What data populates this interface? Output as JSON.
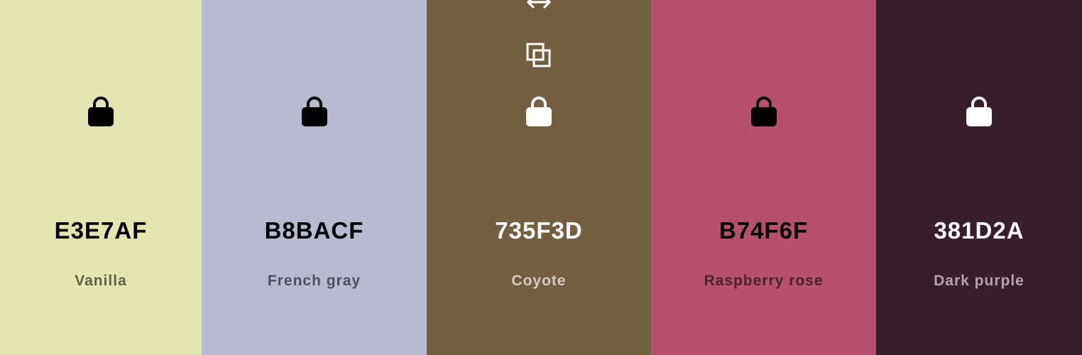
{
  "palette": {
    "colors": [
      {
        "hex": "E3E7AF",
        "name": "Vanilla",
        "background": "#E3E7AF",
        "text_color": "#000000",
        "name_color": "#5E604A",
        "icon_color": "#000000",
        "lock_icon": "lock-icon"
      },
      {
        "hex": "B8BACF",
        "name": "French gray",
        "background": "#B8BACF",
        "text_color": "#000000",
        "name_color": "#4F5059",
        "icon_color": "#000000",
        "lock_icon": "lock-icon"
      },
      {
        "hex": "735F3D",
        "name": "Coyote",
        "background": "#735F3D",
        "text_color": "#FFFFFF",
        "name_color": "#D1CBC0",
        "icon_color": "#FFFFFF",
        "lock_icon": "lock-icon",
        "hover_icons": [
          "drag-arrows-icon",
          "copy-icon"
        ]
      },
      {
        "hex": "B74F6F",
        "name": "Raspberry rose",
        "background": "#B74F6F",
        "text_color": "#000000",
        "name_color": "#4E2230",
        "icon_color": "#000000",
        "lock_icon": "lock-icon"
      },
      {
        "hex": "381D2A",
        "name": "Dark purple",
        "background": "#381D2A",
        "text_color": "#FFFFFF",
        "name_color": "#B0A5AA",
        "icon_color": "#FFFFFF",
        "lock_icon": "lock-icon"
      }
    ]
  }
}
